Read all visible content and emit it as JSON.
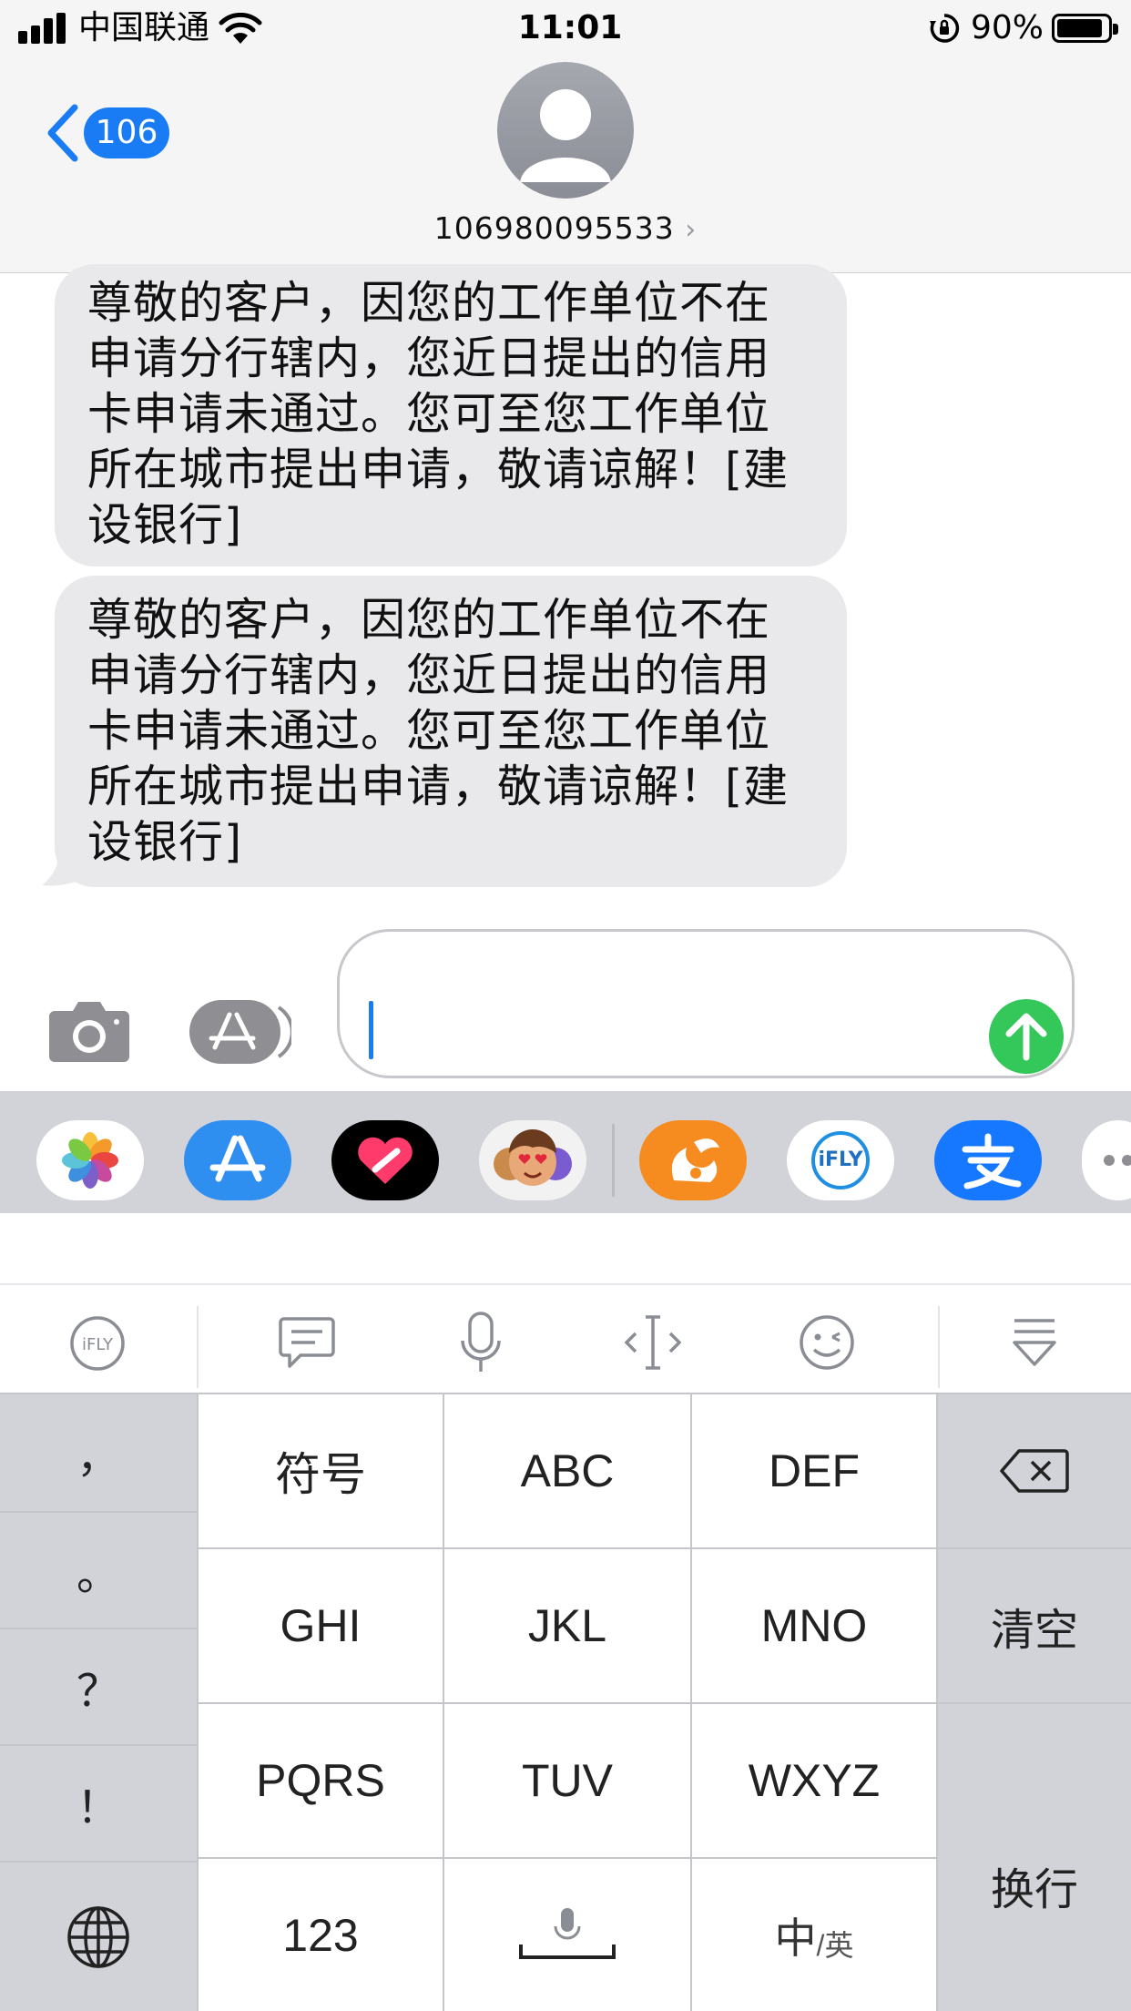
{
  "status_bar": {
    "carrier": "中国联通",
    "time": "11:01",
    "battery": "90%",
    "battery_level": 0.9
  },
  "header": {
    "back_badge": "106",
    "contact": "106980095533"
  },
  "messages": [
    {
      "lines": [
        "尊敬的客户，因您的工作单位不在",
        "申请分行辖内，您近日提出的信用",
        "卡申请未通过。您可至您工作单位",
        "所在城市提出申请，敬请谅解！[建",
        "设银行]"
      ]
    },
    {
      "lines": [
        "尊敬的客户，因您的工作单位不在",
        "申请分行辖内，您近日提出的信用",
        "卡申请未通过。您可至您工作单位",
        "所在城市提出申请，敬请谅解！[建",
        "设银行]"
      ]
    }
  ],
  "apps_row": {
    "icons": [
      "photos-icon",
      "app-store-icon",
      "digital-touch-icon",
      "memoji-icon",
      "uc-browser-icon",
      "ifly-icon",
      "alipay-icon",
      "more-icon"
    ],
    "ifly_label": "iFLY"
  },
  "keyboard": {
    "punctuation": [
      "，",
      "。",
      "？",
      "！"
    ],
    "rows": [
      [
        "符号",
        "ABC",
        "DEF"
      ],
      [
        "GHI",
        "JKL",
        "MNO"
      ],
      [
        "PQRS",
        "TUV",
        "WXYZ"
      ]
    ],
    "bottom": {
      "numbers": "123",
      "lang_main": "中",
      "lang_sub": "/英"
    },
    "clear": "清空",
    "newline": "换行",
    "toolbar_icons": [
      "ifly-logo-icon",
      "clipboard-icon",
      "microphone-icon",
      "cursor-move-icon",
      "emoji-icon",
      "hide-keyboard-icon"
    ]
  },
  "colors": {
    "ios_blue": "#1a7cf5",
    "send_green": "#34c759",
    "bubble_gray": "#e9e9eb",
    "keyboard_side": "#d1d3d9"
  }
}
